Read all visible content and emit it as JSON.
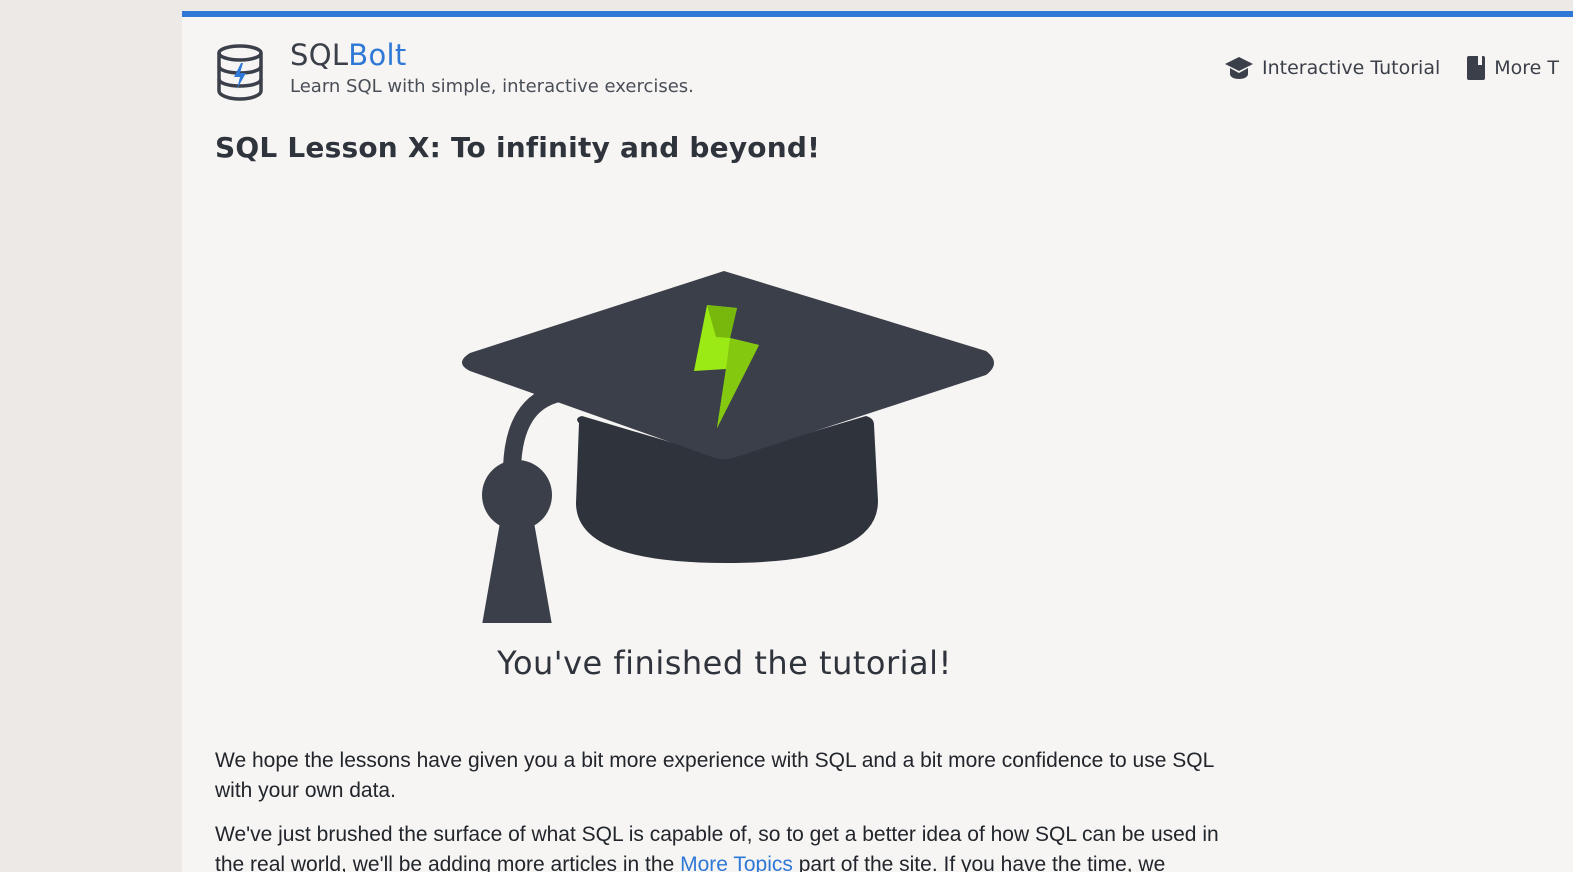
{
  "brand": {
    "name_part1": "SQL",
    "name_part2": "Bolt",
    "tagline": "Learn SQL with simple, interactive exercises.",
    "accent_color": "#2f78d6",
    "logo_icon": "database-bolt-icon"
  },
  "nav": {
    "items": [
      {
        "label": "Interactive Tutorial",
        "icon": "graduation-cap-icon"
      },
      {
        "label": "More T",
        "icon": "book-icon"
      }
    ]
  },
  "lesson": {
    "title": "SQL Lesson X: To infinity and beyond!"
  },
  "hero": {
    "icon": "graduation-cap-bolt-icon",
    "caption": "You've finished the tutorial!"
  },
  "content": {
    "p1": "We hope the lessons have given you a bit more experience with SQL and a bit more confidence to use SQL with your own data.",
    "p2_before": "We've just brushed the surface of what SQL is capable of, so to get a better idea of how SQL can be used in the real world, we'll be adding more articles in the ",
    "p2_link": "More Topics",
    "p2_after": " part of the site. If you have the time, we"
  }
}
